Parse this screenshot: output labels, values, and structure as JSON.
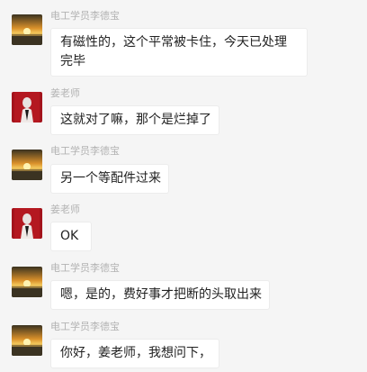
{
  "messages": [
    {
      "sender": "电工学员李德宝",
      "avatar": "sunset-avatar-icon",
      "text": "有磁性的，这个平常被卡住，今天已处理完毕"
    },
    {
      "sender": "姜老师",
      "avatar": "red-figure-avatar-icon",
      "text": "这就对了嘛，那个是烂掉了"
    },
    {
      "sender": "电工学员李德宝",
      "avatar": "sunset-avatar-icon",
      "text": "另一个等配件过来"
    },
    {
      "sender": "姜老师",
      "avatar": "red-figure-avatar-icon",
      "text": "OK"
    },
    {
      "sender": "电工学员李德宝",
      "avatar": "sunset-avatar-icon",
      "text": "嗯，是的，费好事才把断的头取出来"
    },
    {
      "sender": "电工学员李德宝",
      "avatar": "sunset-avatar-icon",
      "text": "你好，姜老师，我想问下，"
    }
  ],
  "colors": {
    "background": "#f5f5f5",
    "bubble": "#ffffff",
    "sender_name": "#b3b3b3"
  }
}
